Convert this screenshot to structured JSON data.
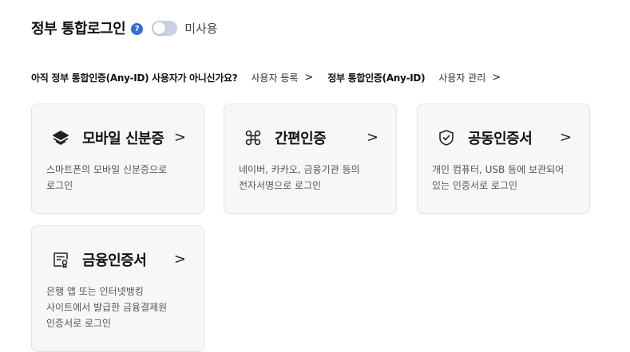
{
  "header": {
    "title": "정부 통합로그인",
    "help_glyph": "?",
    "toggle_label": "미사용",
    "toggle_on": false
  },
  "links": {
    "question": "아직 정부 통합인증(Any-ID) 사용자가 아니신가요?",
    "register": "사용자 등록",
    "any_id_label": "정부 통합인증(Any-ID)",
    "manage": "사용자 관리",
    "chevron": ">"
  },
  "cards": [
    {
      "icon": "layers-icon",
      "title": "모바일 신분증",
      "arrow": ">",
      "desc": "스마트폰의 모바일 신분증으로\n로그인"
    },
    {
      "icon": "command-icon",
      "title": "간편인증",
      "arrow": ">",
      "desc": "네이버, 카카오, 금융기관 등의\n전자서명으로 로그인"
    },
    {
      "icon": "shield-check-icon",
      "title": "공동인증서",
      "arrow": ">",
      "desc": "개인 컴퓨터, USB 등에 보관되어\n있는 인증서로 로그인"
    },
    {
      "icon": "certificate-icon",
      "title": "금융인증서",
      "arrow": ">",
      "desc": "은행 앱 또는 인터넷뱅킹\n사이트에서 발급한 금융결제원\n인증서로 로그인"
    }
  ]
}
